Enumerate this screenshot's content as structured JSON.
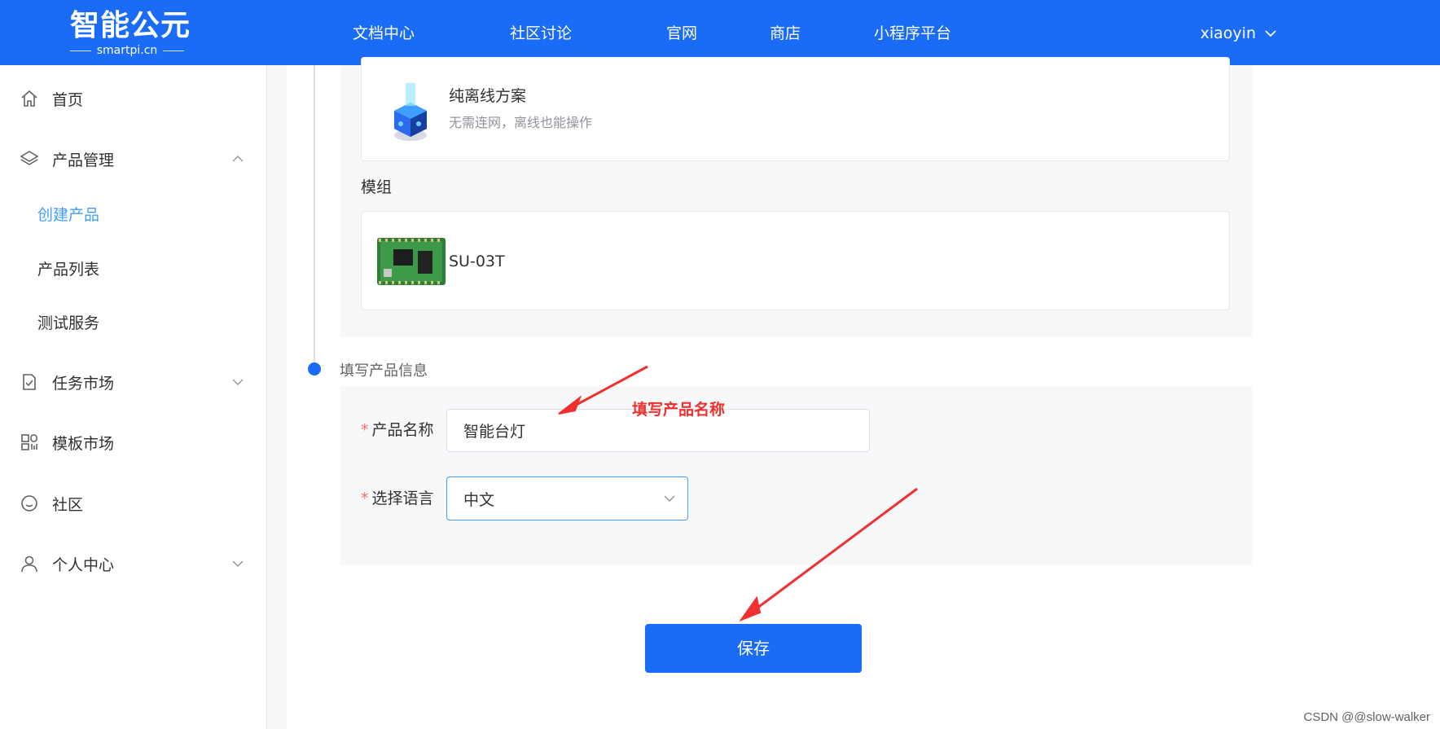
{
  "header": {
    "logo_text": "智能公元",
    "logo_sub": "smartpi.cn",
    "nav": [
      "文档中心",
      "社区讨论",
      "官网",
      "商店",
      "小程序平台"
    ],
    "user": "xiaoyin"
  },
  "sidebar": {
    "items": [
      {
        "label": "首页",
        "icon": "home-icon"
      },
      {
        "label": "产品管理",
        "icon": "layers-icon",
        "expanded": true
      },
      {
        "label": "任务市场",
        "icon": "task-icon"
      },
      {
        "label": "模板市场",
        "icon": "template-grid-icon"
      },
      {
        "label": "社区",
        "icon": "smile-icon"
      },
      {
        "label": "个人中心",
        "icon": "user-icon"
      }
    ],
    "sub_items": [
      {
        "label": "创建产品",
        "active": true
      },
      {
        "label": "产品列表"
      },
      {
        "label": "测试服务"
      }
    ]
  },
  "main": {
    "offline": {
      "title": "纯离线方案",
      "desc": "无需连网，离线也能操作"
    },
    "module_section": "模组",
    "module_name": "SU-03T",
    "step_label": "填写产品信息",
    "form": {
      "name_label": "产品名称",
      "name_value": "智能台灯",
      "lang_label": "选择语言",
      "lang_value": "中文",
      "required_mark": "*"
    },
    "annotation": "填写产品名称",
    "save_label": "保存"
  },
  "watermark": "CSDN @@slow-walker",
  "colors": {
    "primary": "#1a6cf7",
    "active": "#409eff",
    "required": "#f56c6c",
    "annotation": "#f0302e"
  }
}
